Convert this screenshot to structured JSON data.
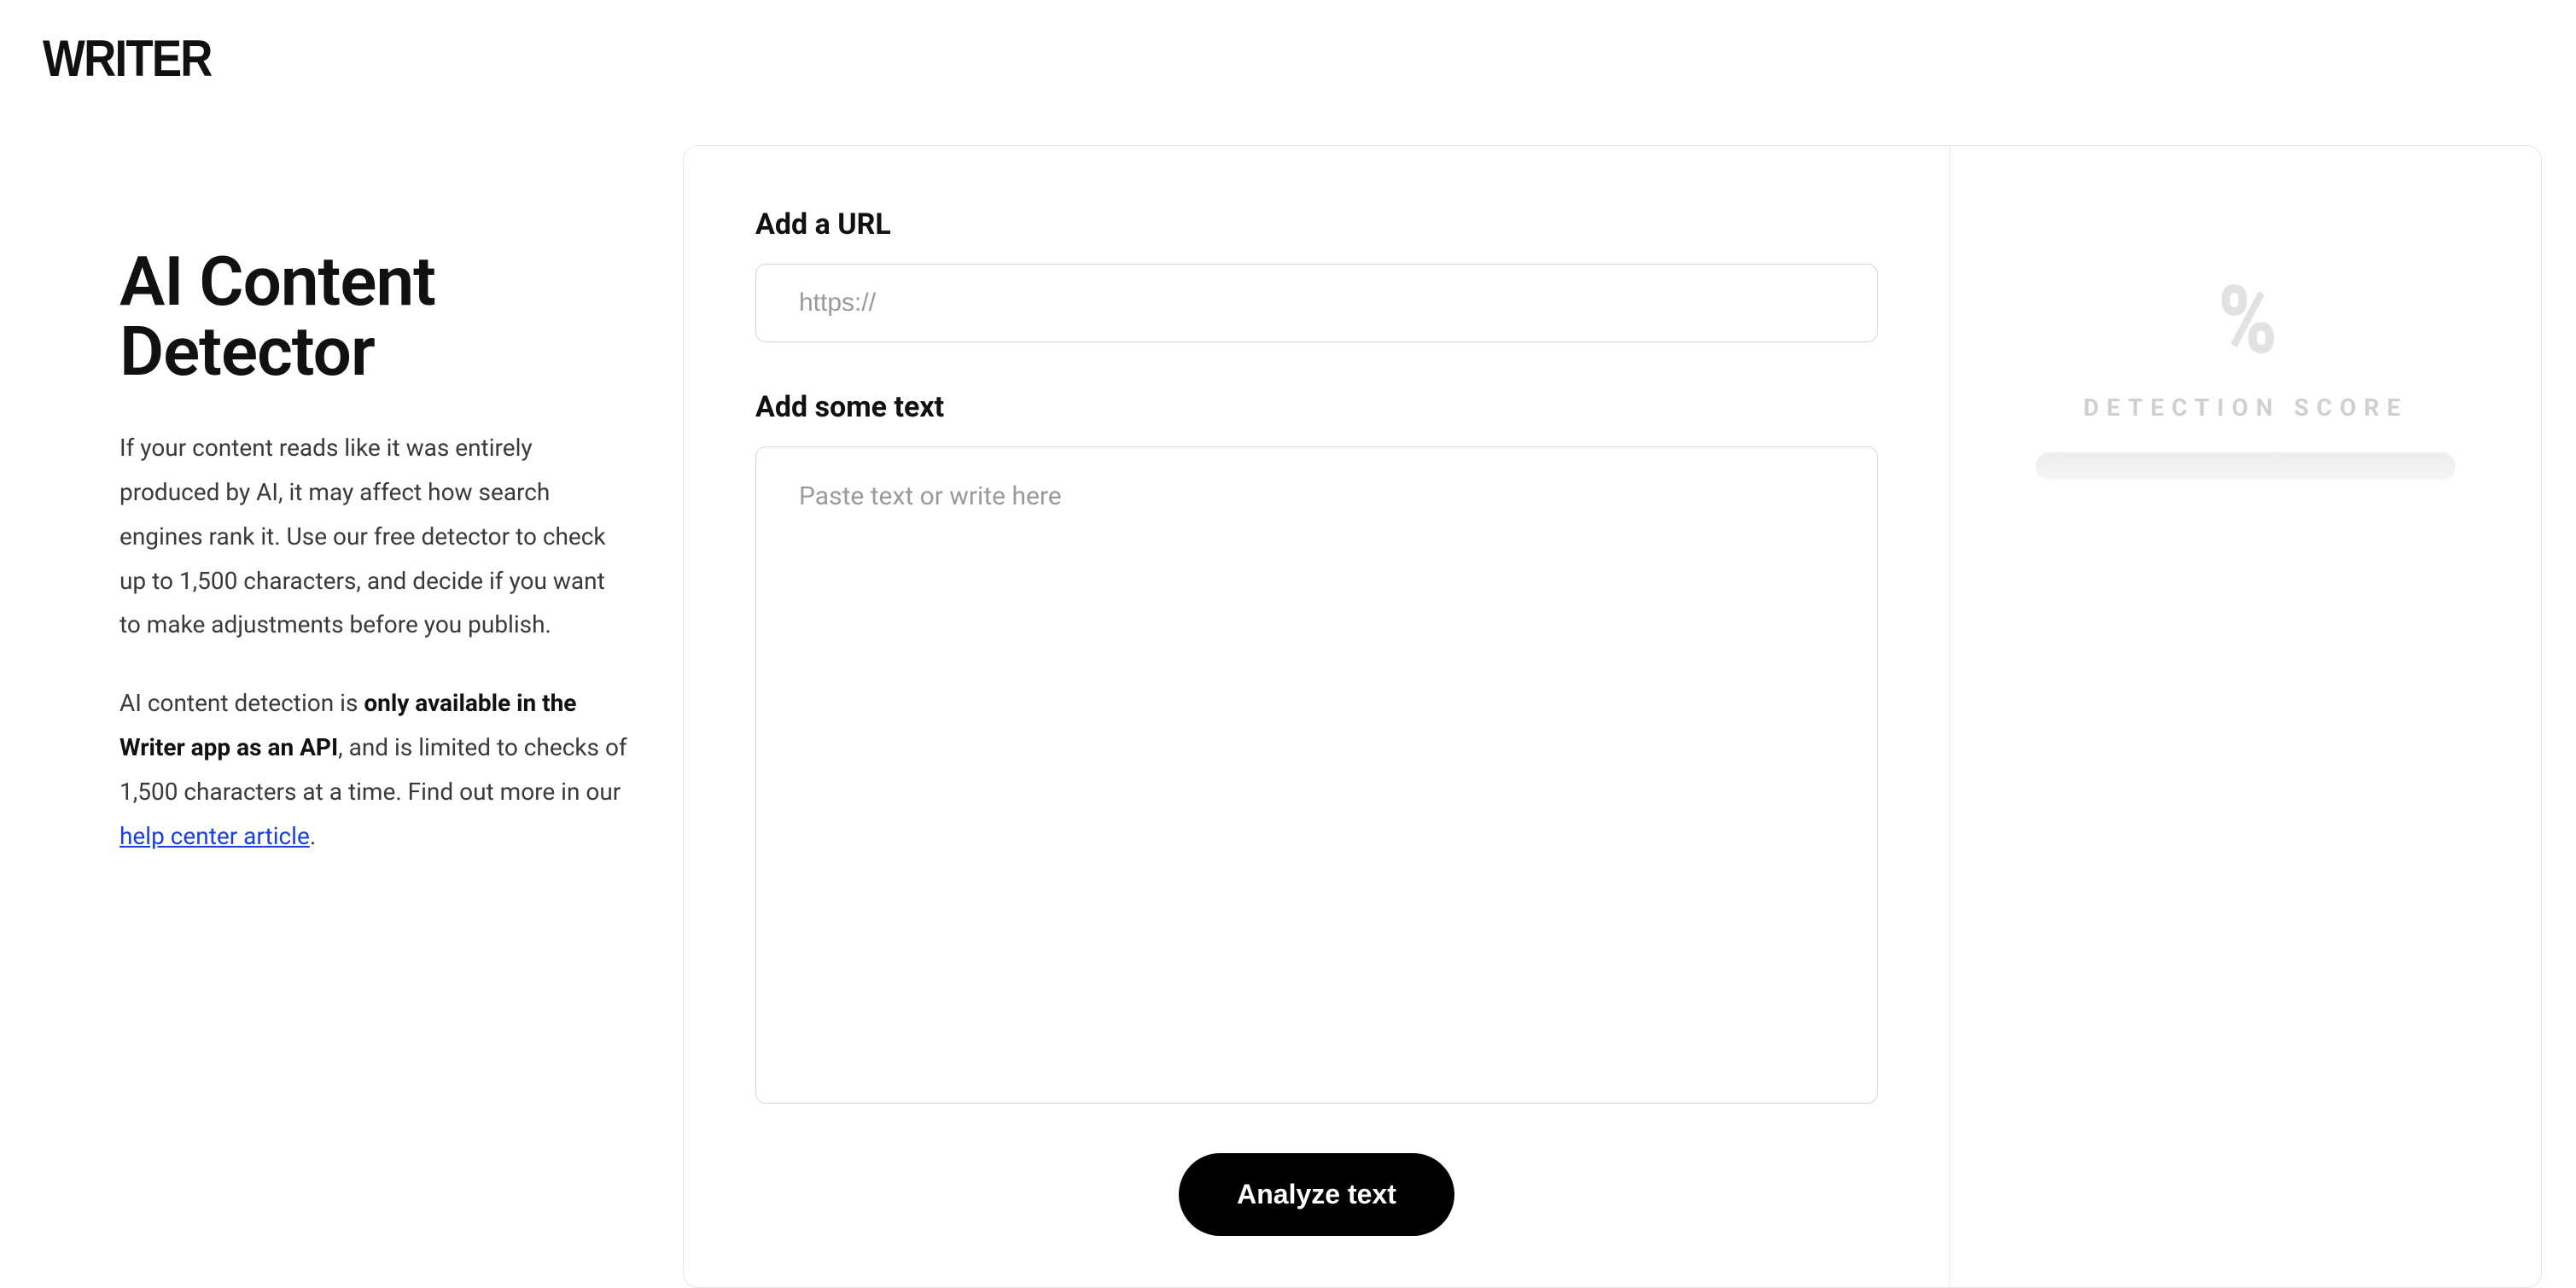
{
  "logo": "WRITER",
  "sidebar": {
    "title": "AI Content Detector",
    "paragraph1": "If your content reads like it was entirely produced by AI, it may affect how search engines rank it. Use our free detector to check up to 1,500 characters, and decide if you want to make adjustments before you publish.",
    "paragraph2_prefix": "AI content detection is ",
    "paragraph2_bold": "only available in the Writer app as an API",
    "paragraph2_mid": ", and is limited to checks of 1,500 characters at a time. Find out more in our ",
    "help_link_text": "help center article",
    "paragraph2_suffix": "."
  },
  "form": {
    "url_label": "Add a URL",
    "url_placeholder": "https://",
    "text_label": "Add some text",
    "text_placeholder": "Paste text or write here",
    "analyze_button": "Analyze text"
  },
  "score": {
    "percent_glyph": "%",
    "label": "DETECTION SCORE"
  }
}
